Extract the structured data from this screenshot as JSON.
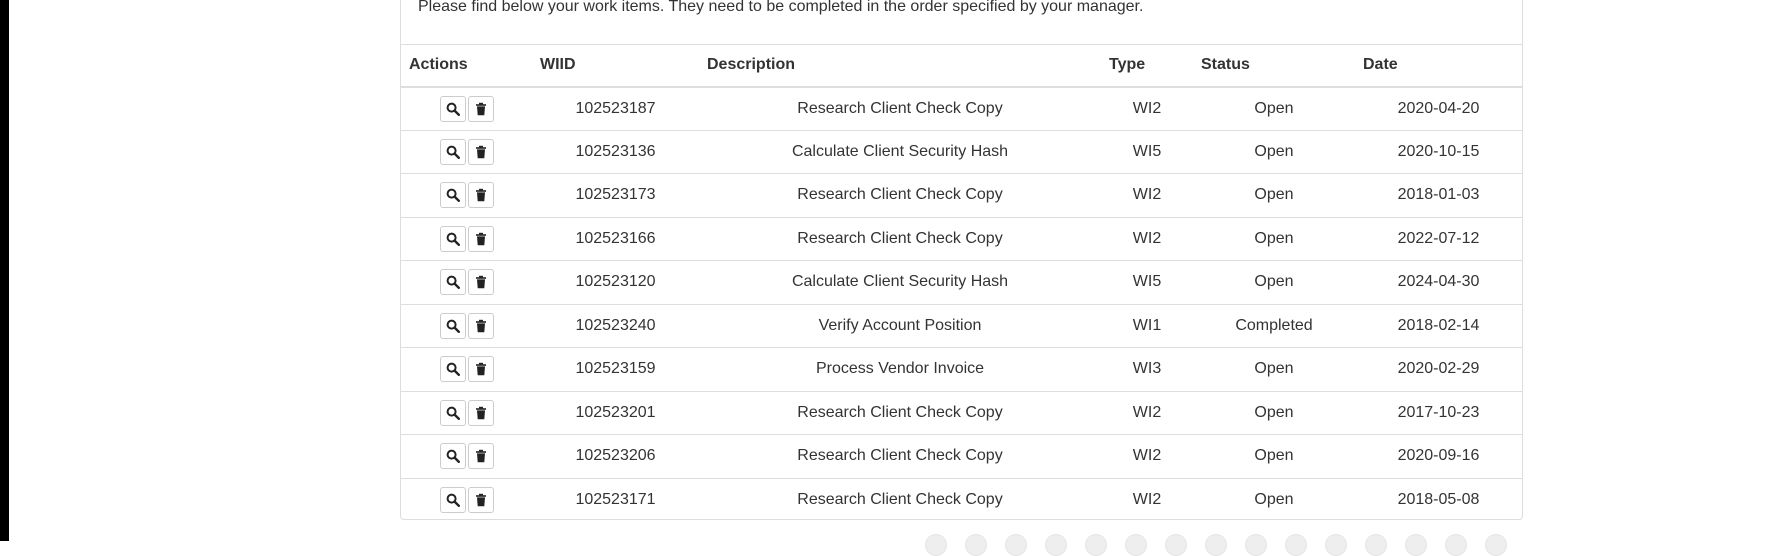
{
  "intro_text": "Please find below your work items. They need to be completed in the order specified by your manager.",
  "table": {
    "headers": {
      "actions": "Actions",
      "wiid": "WIID",
      "description": "Description",
      "type": "Type",
      "status": "Status",
      "date": "Date"
    },
    "rows": [
      {
        "wiid": "102523187",
        "description": "Research Client Check Copy",
        "type": "WI2",
        "status": "Open",
        "date": "2020-04-20"
      },
      {
        "wiid": "102523136",
        "description": "Calculate Client Security Hash",
        "type": "WI5",
        "status": "Open",
        "date": "2020-10-15"
      },
      {
        "wiid": "102523173",
        "description": "Research Client Check Copy",
        "type": "WI2",
        "status": "Open",
        "date": "2018-01-03"
      },
      {
        "wiid": "102523166",
        "description": "Research Client Check Copy",
        "type": "WI2",
        "status": "Open",
        "date": "2022-07-12"
      },
      {
        "wiid": "102523120",
        "description": "Calculate Client Security Hash",
        "type": "WI5",
        "status": "Open",
        "date": "2024-04-30"
      },
      {
        "wiid": "102523240",
        "description": "Verify Account Position",
        "type": "WI1",
        "status": "Completed",
        "date": "2018-02-14"
      },
      {
        "wiid": "102523159",
        "description": "Process Vendor Invoice",
        "type": "WI3",
        "status": "Open",
        "date": "2020-02-29"
      },
      {
        "wiid": "102523201",
        "description": "Research Client Check Copy",
        "type": "WI2",
        "status": "Open",
        "date": "2017-10-23"
      },
      {
        "wiid": "102523206",
        "description": "Research Client Check Copy",
        "type": "WI2",
        "status": "Open",
        "date": "2020-09-16"
      },
      {
        "wiid": "102523171",
        "description": "Research Client Check Copy",
        "type": "WI2",
        "status": "Open",
        "date": "2018-05-08"
      }
    ]
  },
  "icons": {
    "view": "search-icon",
    "delete": "trash-icon"
  },
  "colors": {
    "text": "#333333",
    "border": "#dddddd",
    "icon": "#222222"
  },
  "pager": {
    "count": 15
  }
}
